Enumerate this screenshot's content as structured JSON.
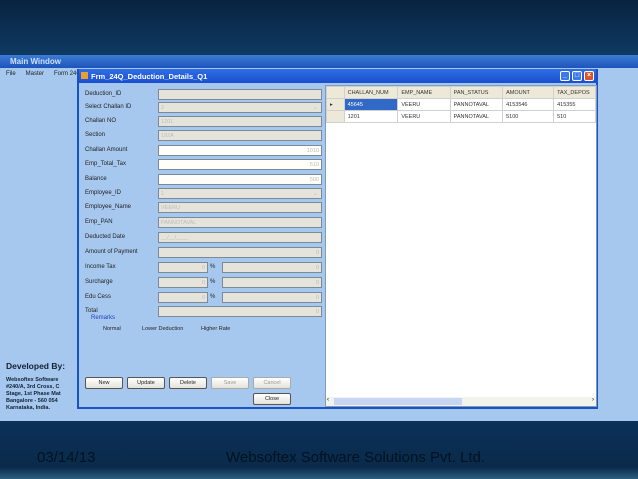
{
  "main_window": {
    "title": "Main Window",
    "menu": [
      "File",
      "Master",
      "Form 24Q"
    ]
  },
  "developer": {
    "heading": "Developed By:",
    "lines": [
      "Websoftex Software",
      "#240/A, 3rd Cross, C",
      "Stage, 1st Phase Mat",
      "Bangalore - 560 054",
      "Karnataka, India."
    ]
  },
  "dialog": {
    "title": "Frm_24Q_Deduction_Details_Q1",
    "fields": [
      {
        "label": "Deduction_ID",
        "value": ""
      },
      {
        "label": "Select Challan ID",
        "value": "2"
      },
      {
        "label": "Challan NO",
        "value": "1201"
      },
      {
        "label": "Section",
        "value": "192A"
      },
      {
        "label": "Challan Amount",
        "value": "1010"
      },
      {
        "label": "Emp_Total_Tax",
        "value": "510"
      },
      {
        "label": "Balance",
        "value": "500"
      },
      {
        "label": "Employee_ID",
        "value": "1"
      },
      {
        "label": "Employee_Name",
        "value": "VEERU"
      },
      {
        "label": "Emp_PAN",
        "value": "PANNOTAVAL"
      },
      {
        "label": "Deducted Date",
        "value": "__/__/____"
      },
      {
        "label": "Amount of Payment",
        "value": "0"
      },
      {
        "label": "Income Tax",
        "value": "0",
        "value2": "0"
      },
      {
        "label": "Surcharge",
        "value": "0",
        "value2": "0"
      },
      {
        "label": "Edu Cess",
        "value": "0",
        "value2": "0"
      },
      {
        "label": "Total",
        "value": "0"
      }
    ],
    "percent_sign": "%",
    "remarks": {
      "label": "Remarks",
      "options": [
        "Normal",
        "Lower Deduction",
        "Higher Rate"
      ]
    },
    "buttons": {
      "new": "New",
      "update": "Update",
      "delete": "Delete",
      "save": "Save",
      "cancel": "Cancel",
      "close": "Close"
    },
    "grid": {
      "columns": [
        "CHALLAN_NUM",
        "EMP_NAME",
        "PAN_STATUS",
        "AMOUNT",
        "TAX_DEPOS"
      ],
      "rows": [
        [
          "45645",
          "VEERU",
          "PANNOTAVAL",
          "4153546",
          "415355"
        ],
        [
          "1201",
          "VEERU",
          "PANNOTAVAL",
          "5100",
          "510"
        ]
      ]
    }
  },
  "footer": {
    "date": "03/14/13",
    "company": "Websoftex Software Solutions Pvt. Ltd."
  }
}
